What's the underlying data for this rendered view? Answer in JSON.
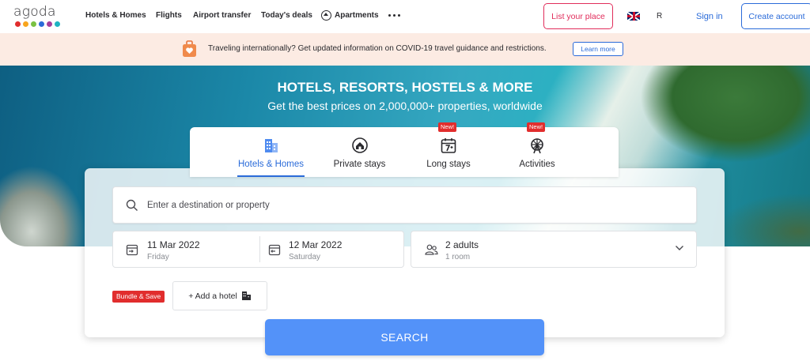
{
  "header": {
    "logo_text": "agoda",
    "logo_colors": [
      "#e12d2d",
      "#f8a51e",
      "#7ac143",
      "#2a6bd9",
      "#a73e9b",
      "#1fb3c2"
    ],
    "nav": [
      {
        "label": "Hotels & Homes"
      },
      {
        "label": "Flights"
      },
      {
        "label": "Airport transfer"
      },
      {
        "label": "Today's deals"
      },
      {
        "label": "Apartments",
        "icon": "home-icon"
      }
    ],
    "more_icon": "more-icon",
    "list_place": "List your place",
    "flag_icon": "uk-flag-icon",
    "currency": "R",
    "sign_in": "Sign in",
    "create_account": "Create account"
  },
  "covid_banner": {
    "icon": "suitcase-heart-icon",
    "text": "Traveling internationally? Get updated information on COVID-19 travel guidance and restrictions.",
    "button": "Learn more"
  },
  "hero": {
    "title": "HOTELS, RESORTS, HOSTELS & MORE",
    "subtitle": "Get the best prices on 2,000,000+ properties, worldwide"
  },
  "tabs": [
    {
      "label": "Hotels & Homes",
      "icon": "hotel-icon",
      "active": true,
      "badge": ""
    },
    {
      "label": "Private stays",
      "icon": "home-icon",
      "active": false,
      "badge": ""
    },
    {
      "label": "Long stays",
      "icon": "calendar-7-icon",
      "active": false,
      "badge": "New!"
    },
    {
      "label": "Activities",
      "icon": "ferris-wheel-icon",
      "active": false,
      "badge": "New!"
    }
  ],
  "search": {
    "destination_placeholder": "Enter a destination or property",
    "checkin": {
      "date": "11 Mar 2022",
      "day": "Friday"
    },
    "checkout": {
      "date": "12 Mar 2022",
      "day": "Saturday"
    },
    "guests": {
      "main": "2 adults",
      "sub": "1 room"
    },
    "bundle_badge": "Bundle & Save",
    "add_hotel": "+ Add a hotel",
    "search_button": "SEARCH"
  },
  "colors": {
    "accent": "#2a6bd9",
    "search_button": "#5392f9",
    "brand_pink": "#e12d5b",
    "badge_red": "#e12d2d"
  }
}
